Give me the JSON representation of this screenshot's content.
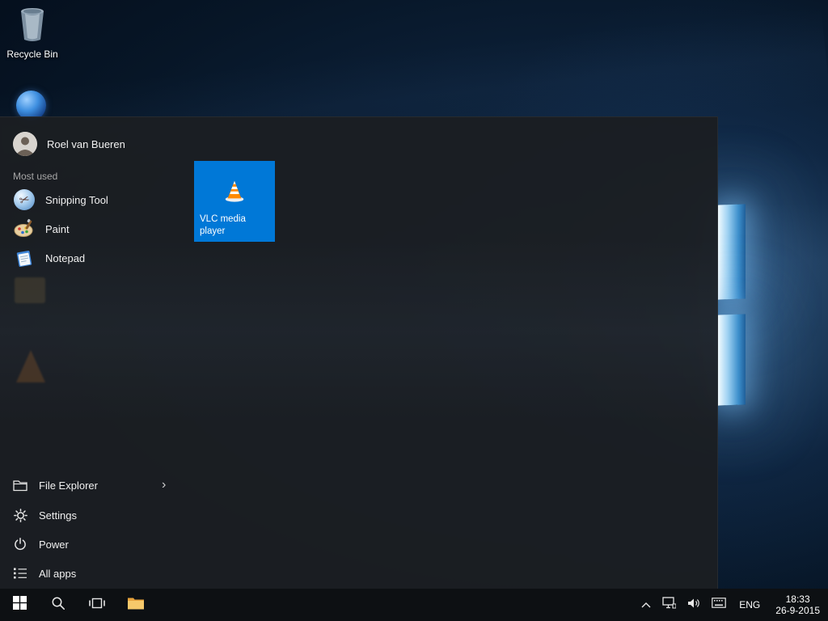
{
  "desktop": {
    "recycle_bin_label": "Recycle Bin"
  },
  "start_menu": {
    "user_name": "Roel van Bueren",
    "most_used_label": "Most used",
    "most_used": [
      {
        "label": "Snipping Tool"
      },
      {
        "label": "Paint"
      },
      {
        "label": "Notepad"
      }
    ],
    "tile": {
      "label": "VLC media player"
    },
    "bottom": {
      "file_explorer": "File Explorer",
      "settings": "Settings",
      "power": "Power",
      "all_apps": "All apps"
    }
  },
  "taskbar": {
    "language": "ENG",
    "time": "18:33",
    "date": "26-9-2015"
  },
  "icons": {
    "scissors": "✂",
    "chevron_right": "›"
  },
  "colors": {
    "accent": "#0078d7",
    "menu_bg": "#1b1e22",
    "taskbar_bg": "#0d1013"
  }
}
